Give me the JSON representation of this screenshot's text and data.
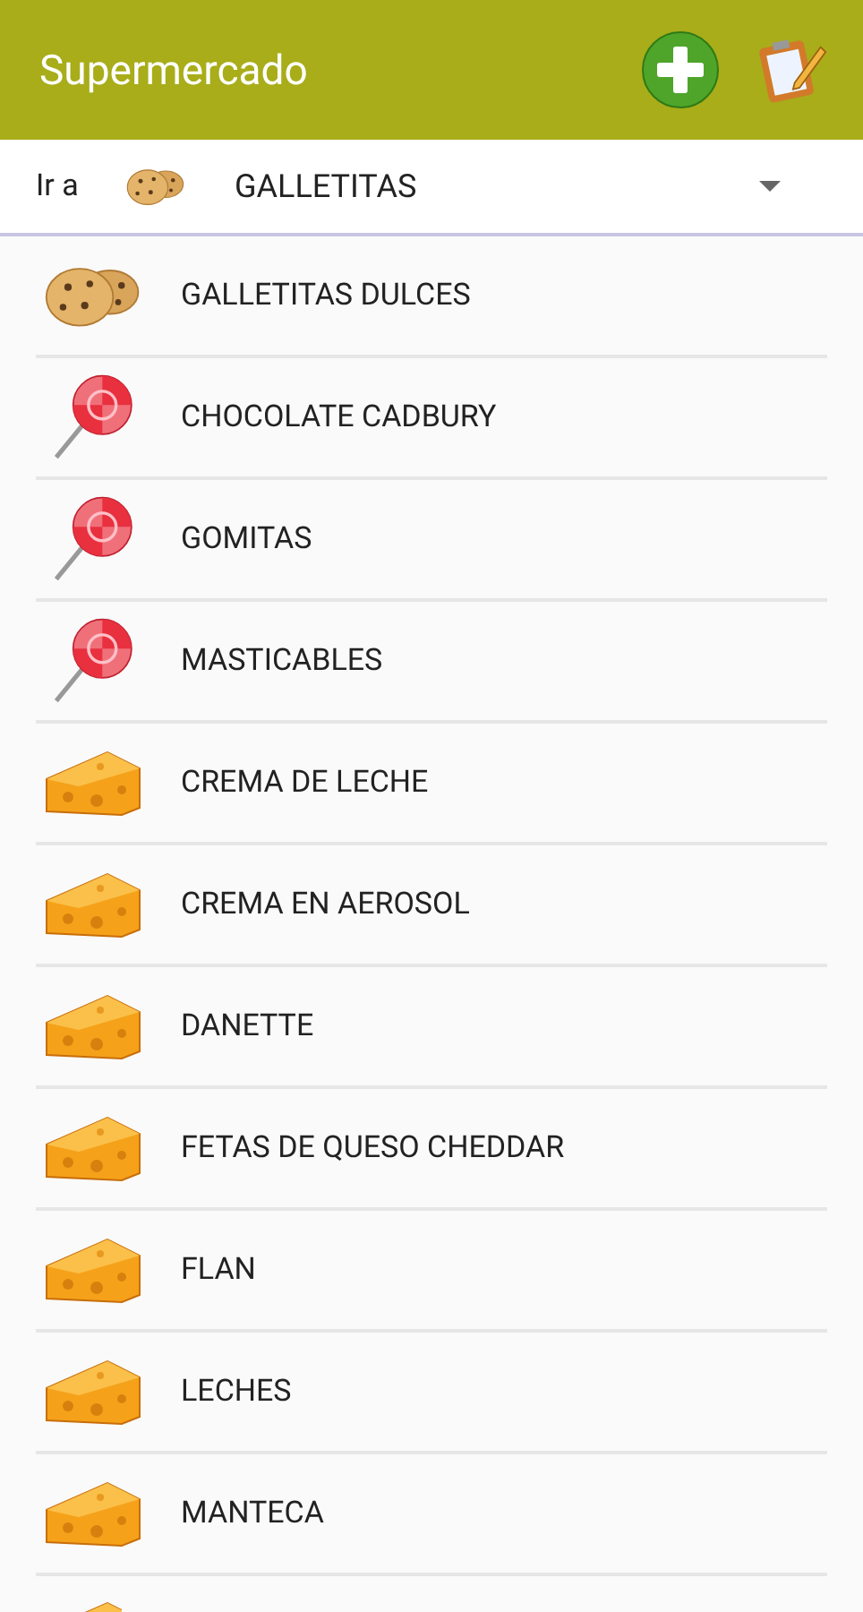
{
  "app_bar": {
    "title": "Supermercado"
  },
  "category_selector": {
    "label": "Ir a",
    "kind": "cookie",
    "value": "GALLETITAS"
  },
  "items": [
    {
      "kind": "cookie",
      "name": "GALLETITAS DULCES"
    },
    {
      "kind": "lollipop",
      "name": "CHOCOLATE CADBURY"
    },
    {
      "kind": "lollipop",
      "name": "GOMITAS"
    },
    {
      "kind": "lollipop",
      "name": "MASTICABLES"
    },
    {
      "kind": "cheese",
      "name": "CREMA DE LECHE"
    },
    {
      "kind": "cheese",
      "name": "CREMA EN AEROSOL"
    },
    {
      "kind": "cheese",
      "name": "DANETTE"
    },
    {
      "kind": "cheese",
      "name": "FETAS DE QUESO CHEDDAR"
    },
    {
      "kind": "cheese",
      "name": "FLAN"
    },
    {
      "kind": "cheese",
      "name": "LECHES"
    },
    {
      "kind": "cheese",
      "name": "MANTECA"
    },
    {
      "kind": "cheese"
    }
  ]
}
